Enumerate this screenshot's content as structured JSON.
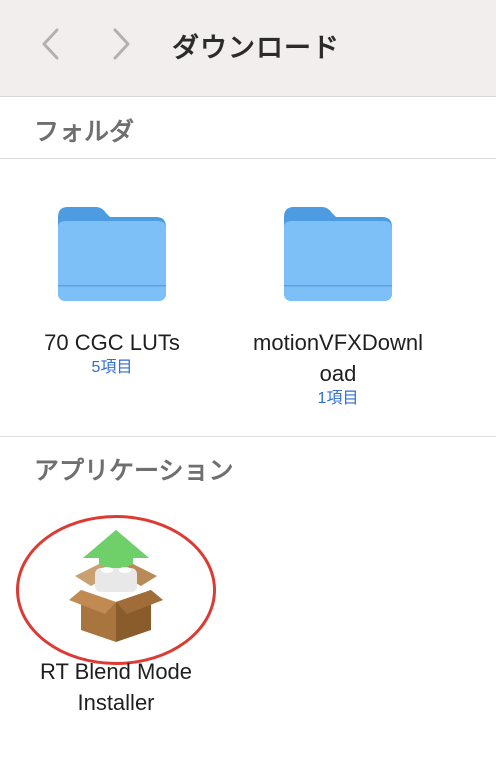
{
  "toolbar": {
    "title": "ダウンロード",
    "back_icon": "chevron-left-icon",
    "forward_icon": "chevron-right-icon"
  },
  "sections": {
    "folders": {
      "title": "フォルダ",
      "items": [
        {
          "name": "70 CGC LUTs",
          "sub": "5項目",
          "icon": "folder-icon"
        },
        {
          "name_line1": "motionVFXDownl",
          "name_line2": "oad",
          "sub": "1項目",
          "icon": "folder-icon"
        }
      ]
    },
    "apps": {
      "title": "アプリケーション",
      "items": [
        {
          "name_line1": "RT Blend Mode",
          "name_line2": "Installer",
          "icon": "installer-package-icon"
        }
      ]
    }
  },
  "colors": {
    "toolbar_bg": "#f3eeee",
    "folder_blue": "#5aa9ee",
    "subtitle_blue": "#2f6fd0",
    "highlight_red": "#dc3b33"
  }
}
